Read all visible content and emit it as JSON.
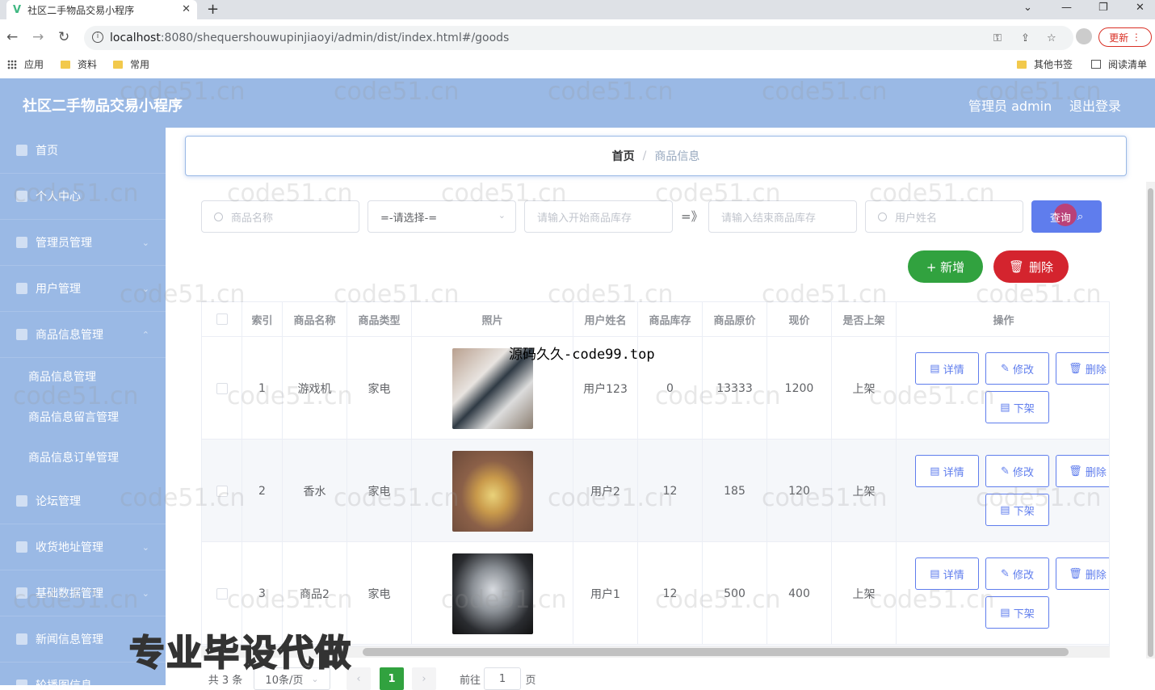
{
  "browser": {
    "tab_title": "社区二手物品交易小程序",
    "url_host": "localhost",
    "url_rest": ":8080/shequershouwupinjiaoyi/admin/dist/index.html#/goods",
    "update_label": "更新",
    "bookmarks": {
      "apps": "应用",
      "b1": "资料",
      "b2": "常用",
      "other": "其他书签",
      "reading": "阅读清单"
    }
  },
  "header": {
    "title": "社区二手物品交易小程序",
    "user": "管理员 admin",
    "logout": "退出登录"
  },
  "sidebar": {
    "items": [
      {
        "label": "首页"
      },
      {
        "label": "个人中心"
      },
      {
        "label": "管理员管理"
      },
      {
        "label": "用户管理"
      },
      {
        "label": "商品信息管理"
      },
      {
        "label": "论坛管理"
      },
      {
        "label": "收货地址管理"
      },
      {
        "label": "基础数据管理"
      },
      {
        "label": "新闻信息管理"
      },
      {
        "label": "轮播图信息"
      }
    ],
    "sub_items": [
      {
        "label": "商品信息管理"
      },
      {
        "label": "商品信息留言管理"
      },
      {
        "label": "商品信息订单管理"
      }
    ]
  },
  "breadcrumb": {
    "home": "首页",
    "current": "商品信息"
  },
  "search": {
    "name_placeholder": "商品名称",
    "type_select": "=-请选择-=",
    "start_stock_placeholder": "请输入开始商品库存",
    "arrow": "=》",
    "end_stock_placeholder": "请输入结束商品库存",
    "user_placeholder": "用户姓名",
    "query_label": "查询"
  },
  "actions": {
    "add_label": "+ 新增",
    "delete_label": "删除"
  },
  "table": {
    "headers": [
      "",
      "索引",
      "商品名称",
      "商品类型",
      "照片",
      "用户姓名",
      "商品库存",
      "商品原价",
      "现价",
      "是否上架",
      "操作"
    ],
    "rows": [
      {
        "index": "1",
        "name": "游戏机",
        "type": "家电",
        "user": "用户123",
        "stock": "0",
        "orig": "13333",
        "price": "1200",
        "status": "上架"
      },
      {
        "index": "2",
        "name": "香水",
        "type": "家电",
        "user": "用户2",
        "stock": "12",
        "orig": "185",
        "price": "120",
        "status": "上架"
      },
      {
        "index": "3",
        "name": "商品2",
        "type": "家电",
        "user": "用户1",
        "stock": "12",
        "orig": "500",
        "price": "400",
        "status": "上架"
      }
    ],
    "op_labels": {
      "detail": "详情",
      "edit": "修改",
      "delete": "删除",
      "offshelf": "下架"
    }
  },
  "pagination": {
    "total": "共 3 条",
    "page_size": "10条/页",
    "current": "1",
    "goto": "前往",
    "goto_value": "1",
    "page_unit": "页"
  },
  "watermarks": {
    "site": "code51.cn",
    "banner": "源码久久-code99.top",
    "big": "专业毕设代做"
  },
  "colors": {
    "primary": "#5f7ded",
    "sidebar": "#9ab9e5",
    "success": "#31a23f",
    "danger": "#d4242e"
  }
}
